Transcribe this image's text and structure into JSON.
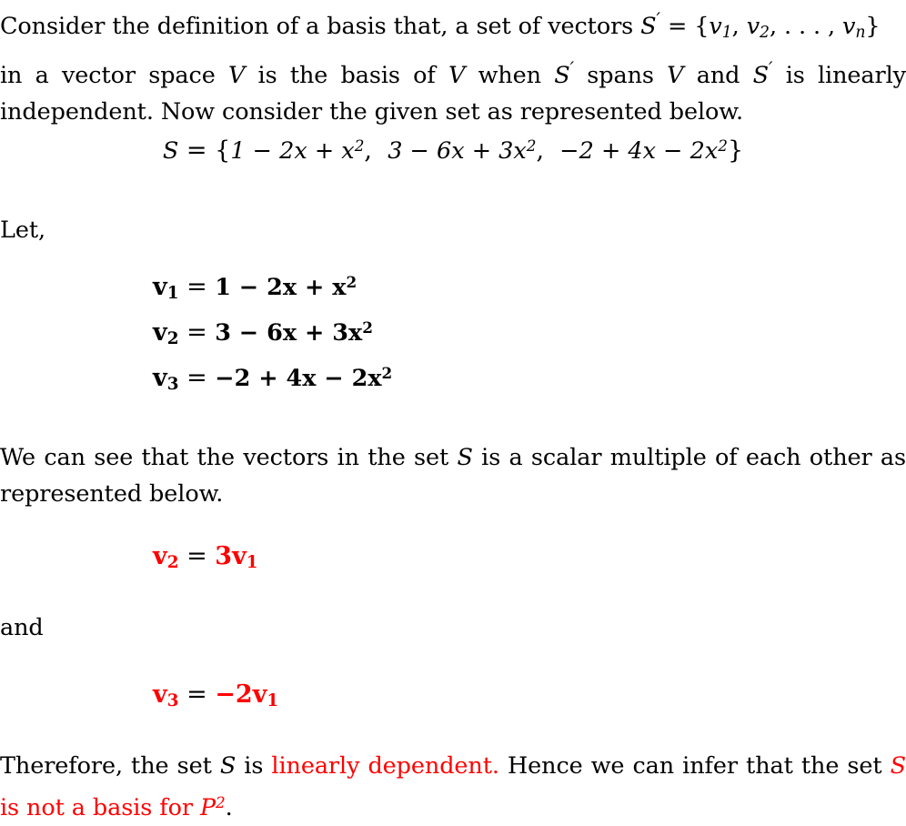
{
  "document": {
    "type": "math-solution",
    "accent_color": "#FF0000",
    "text_color": "#000000",
    "background": "#FFFFFF"
  },
  "intro": {
    "part1": "Consider the definition of a basis that, a set of vectors ",
    "set_symbol": "S",
    "prime": "′",
    "equals": "=",
    "brace_open": "{",
    "v1": "v",
    "v1_sub": "1",
    "comma1": ",",
    "v2": "v",
    "v2_sub": "2",
    "comma2": ",",
    "dots": ". . . ,",
    "vn": "v",
    "vn_sub": "n",
    "brace_close": "}",
    "part2_a": "in a vector space ",
    "V_a": "V",
    "part2_b": " is the basis of ",
    "V_b": "V",
    "part2_c": " when ",
    "S_b": "S",
    "part2_d": " spans ",
    "V_c": "V",
    "part2_e": " and ",
    "S_c": "S",
    "part2_f": " is linearly independent. Now consider the given set as represented below."
  },
  "set_display": {
    "lhs": "S",
    "equals": "=",
    "brace_open": "{",
    "poly1": "1 − 2x + x",
    "poly1_exp": "2",
    "sep1": ", ",
    "poly2": "3 − 6x + 3x",
    "poly2_exp": "2",
    "sep2": ", ",
    "poly3": "−2 + 4x − 2x",
    "poly3_exp": "2",
    "brace_close": "}"
  },
  "let_label": "Let,",
  "vectors": [
    {
      "name": "v",
      "sub": "1",
      "equals": "=",
      "rhs_pre": "1 − 2x + x",
      "rhs_exp": "2"
    },
    {
      "name": "v",
      "sub": "2",
      "equals": "=",
      "rhs_pre": "3 − 6x + 3x",
      "rhs_exp": "2"
    },
    {
      "name": "v",
      "sub": "3",
      "equals": "=",
      "rhs_pre": "−2 + 4x − 2x",
      "rhs_exp": "2"
    }
  ],
  "scalar_para": {
    "part1": "We can see that the vectors in the set ",
    "set_symbol": "S",
    "part2": " is a scalar multiple of each other as represented below."
  },
  "relation1": {
    "lhs_name": "v",
    "lhs_sub": "2",
    "equals": "=",
    "coef": "3",
    "rhs_name": "v",
    "rhs_sub": "1"
  },
  "and_label": "and",
  "relation2": {
    "lhs_name": "v",
    "lhs_sub": "3",
    "equals": "=",
    "coef": "−2",
    "rhs_name": "v",
    "rhs_sub": "1"
  },
  "conclusion": {
    "part1": "Therefore, the set ",
    "set_symbol": "S",
    "part2": " is ",
    "highlight": "linearly dependent.",
    "part3": " Hence we can infer that the set ",
    "red_S": "S",
    "red_tail": " is not a basis for ",
    "red_P": "P",
    "red_P_exp": "2",
    "final_period": "."
  }
}
